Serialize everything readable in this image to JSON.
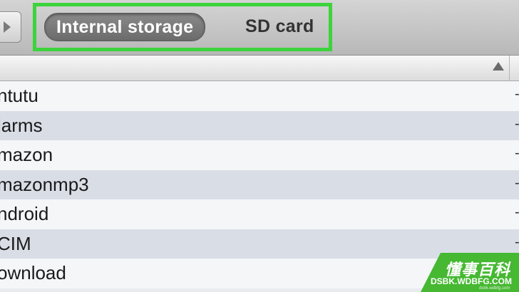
{
  "toolbar": {
    "segments": [
      {
        "label": "Internal storage",
        "selected": true
      },
      {
        "label": "SD card",
        "selected": false
      }
    ],
    "highlight_color": "#3cd33c"
  },
  "column_header": {
    "sort_indicator": "sort-ascending-icon"
  },
  "files": [
    {
      "name": "ntutu"
    },
    {
      "name": "larms"
    },
    {
      "name": "mazon"
    },
    {
      "name": "mazonmp3"
    },
    {
      "name": "ndroid"
    },
    {
      "name": "CIM"
    },
    {
      "name": "ownload"
    }
  ],
  "row_marker": "-",
  "watermark": {
    "title": "懂事百科",
    "url": "DSBK.WDBFG.COM",
    "small": "dsbk.wdbfg.com",
    "color": "#46b832"
  }
}
